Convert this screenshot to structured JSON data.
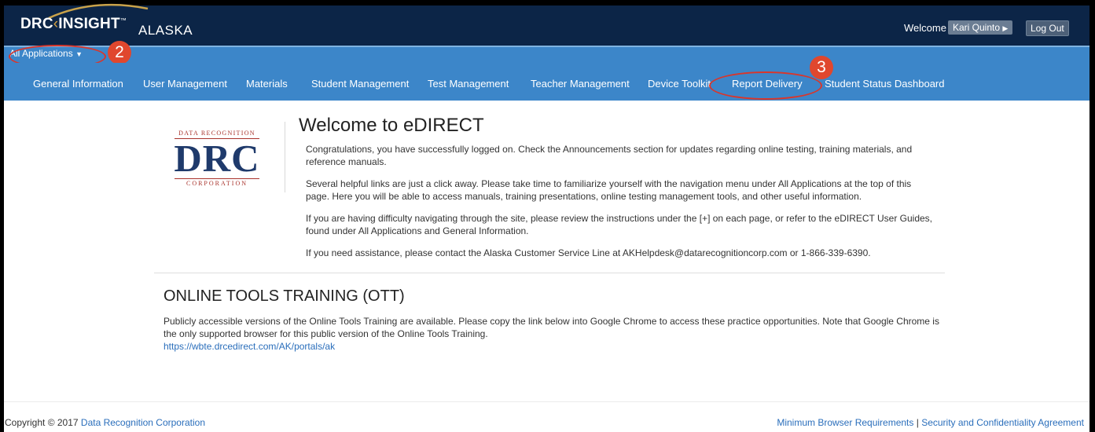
{
  "header": {
    "brand_left": "DRC",
    "brand_right": "INSIGHT",
    "brand_tm": "™",
    "state": "ALASKA",
    "welcome_label": "Welcome",
    "user_name": "Kari Quinto",
    "logout_label": "Log Out"
  },
  "app_menu": {
    "label": "All Applications"
  },
  "nav": {
    "items": [
      "General Information",
      "User Management",
      "Materials",
      "Student Management",
      "Test Management",
      "Teacher Management",
      "Device Toolkit",
      "Report Delivery",
      "Student Status Dashboard"
    ]
  },
  "callouts": {
    "badge_app_menu": "2",
    "badge_report": "3"
  },
  "logo": {
    "top": "DATA RECOGNITION",
    "mark": "DRC",
    "bottom": "CORPORATION"
  },
  "welcome": {
    "title": "Welcome to eDIRECT",
    "p1": "Congratulations, you have successfully logged on. Check the Announcements section for updates regarding online testing, training materials, and reference manuals.",
    "p2": "Several helpful links are just a click away. Please take time to familiarize yourself with the navigation menu under All Applications at the top of this page. Here you will be able to access manuals, training presentations, online testing management tools, and other useful information.",
    "p3": "If you are having difficulty navigating through the site, please review the instructions under the [+] on each page, or refer to the eDIRECT User Guides, found under All Applications and General Information.",
    "p4": "If you need assistance, please contact the Alaska Customer Service Line at AKHelpdesk@datarecognitioncorp.com or 1-866-339-6390."
  },
  "ott": {
    "title": "ONLINE TOOLS TRAINING (OTT)",
    "text": "Publicly accessible versions of the Online Tools Training are available. Please copy the link below into Google Chrome to access these practice opportunities. Note that Google Chrome is the only supported browser for this public version of the Online Tools Training.",
    "link": "https://wbte.drcedirect.com/AK/portals/ak"
  },
  "footer": {
    "copyright_prefix": "Copyright © 2017",
    "company_link": "Data Recognition Corporation",
    "link1": "Minimum Browser Requirements",
    "separator": "|",
    "link2": "Security and Confidentiality Agreement"
  },
  "colors": {
    "header_bg": "#0c2547",
    "nav_bg": "#3c86c9",
    "callout_red": "#d9362b",
    "logo_navy": "#1f3a6b",
    "logo_red": "#a8322b",
    "link": "#2a6ebb"
  }
}
